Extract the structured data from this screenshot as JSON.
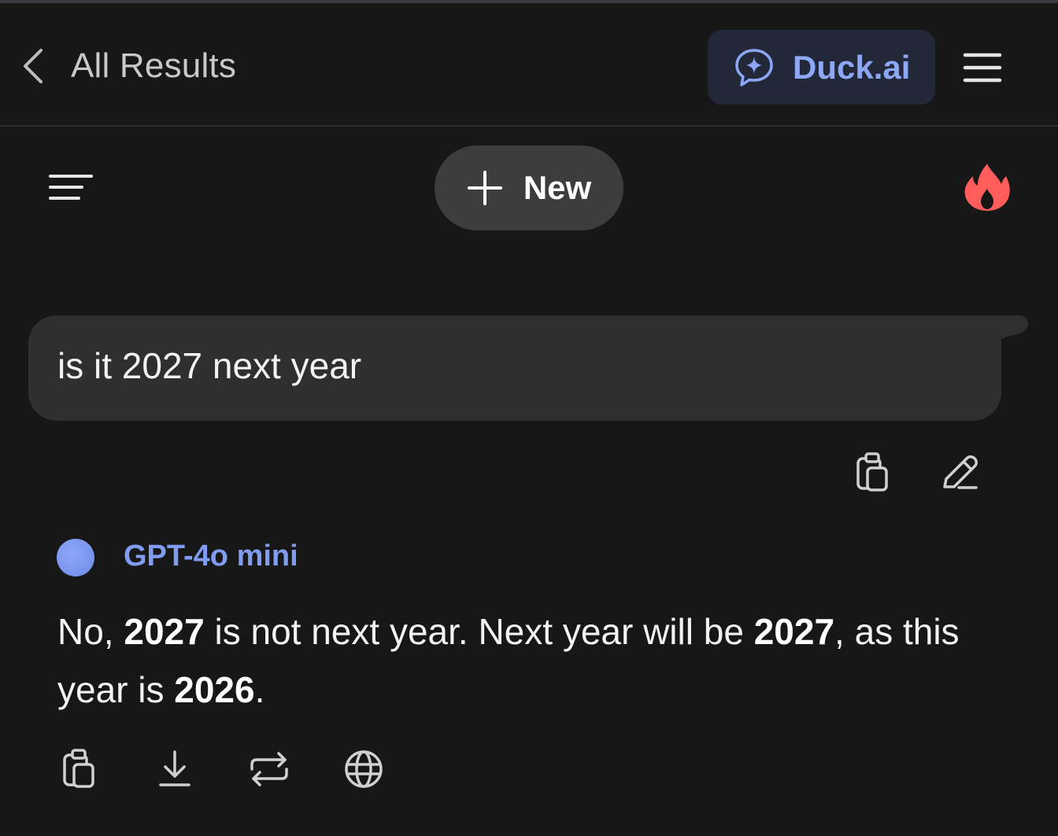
{
  "header": {
    "back_label": "All Results",
    "duck_label": "Duck.ai",
    "accent": "#8da6f5",
    "icons": {
      "back": "chevron-left-icon",
      "duck": "chat-sparkle-icon",
      "menu": "hamburger-menu-icon"
    }
  },
  "toolbar": {
    "new_label": "New",
    "icons": {
      "sidebar": "sidebar-toggle-icon",
      "new": "plus-icon",
      "fire": "fire-icon"
    },
    "fire_color": "#ff5c5c"
  },
  "conversation": {
    "user_message": "is it 2027 next year",
    "user_actions": [
      "copy-icon",
      "edit-icon"
    ],
    "assistant": {
      "model_name": "GPT-4o mini",
      "answer_parts": [
        {
          "text": "No, ",
          "bold": false
        },
        {
          "text": "2027",
          "bold": true
        },
        {
          "text": " is not next year. Next year will be ",
          "bold": false
        },
        {
          "text": "2027",
          "bold": true
        },
        {
          "text": ", as this year is ",
          "bold": false
        },
        {
          "text": "2026",
          "bold": true
        },
        {
          "text": ".",
          "bold": false
        }
      ],
      "actions": [
        "copy-icon",
        "download-icon",
        "regenerate-icon",
        "globe-icon"
      ]
    }
  }
}
